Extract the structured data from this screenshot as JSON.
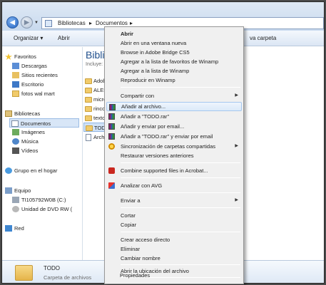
{
  "address": {
    "back_glyph": "◀",
    "forward_glyph": "▶",
    "history_glyph": "▼",
    "crumbs": [
      "Bibliotecas",
      "▸",
      "Documentos",
      "▸"
    ]
  },
  "toolbar": {
    "organize": "Organizar ▾",
    "open": "Abrir",
    "new_folder": "va carpeta"
  },
  "nav": {
    "items": [
      {
        "label": "Favoritos",
        "icon": "star-icon"
      },
      {
        "label": "Descargas",
        "icon": "downloads-icon"
      },
      {
        "label": "Sitios recientes",
        "icon": "recent-places-icon"
      },
      {
        "label": "Escritorio",
        "icon": "desktop-icon"
      },
      {
        "label": "fotos wal mart",
        "icon": "folder-icon"
      },
      {
        "label": "Bibliotecas",
        "icon": "libraries-icon"
      },
      {
        "label": "Documentos",
        "icon": "documents-icon"
      },
      {
        "label": "Imágenes",
        "icon": "pictures-icon"
      },
      {
        "label": "Música",
        "icon": "music-icon"
      },
      {
        "label": "Vídeos",
        "icon": "videos-icon"
      },
      {
        "label": "Grupo en el hogar",
        "icon": "homegroup-icon"
      },
      {
        "label": "Equipo",
        "icon": "computer-icon"
      },
      {
        "label": "TI105792W0B (C:)",
        "icon": "drive-icon"
      },
      {
        "label": "Unidad de DVD RW (",
        "icon": "dvd-icon"
      },
      {
        "label": "Red",
        "icon": "network-icon"
      }
    ]
  },
  "content": {
    "title": "Biblio",
    "includes": "Incluye:",
    "files": [
      "Adob",
      "ALES",
      "micro",
      "rinco",
      "texto",
      "TODO",
      "Archi"
    ]
  },
  "details": {
    "name": "TODO",
    "type": "Carpeta de archivos"
  },
  "menu": {
    "items": [
      {
        "label": "Abrir",
        "bold": true
      },
      {
        "label": "Abrir en una ventana nueva"
      },
      {
        "label": "Browse in Adobe Bridge CS5"
      },
      {
        "label": "Agregar a la lista de favoritos de Winamp"
      },
      {
        "label": "Agregar a la lista de Winamp"
      },
      {
        "label": "Reproducir en Winamp"
      },
      {
        "label": "Compartir con",
        "submenu": true
      },
      {
        "label": "Añadir al archivo...",
        "icon": "winrar-icon",
        "highlight": true
      },
      {
        "label": "Añadir a \"TODO.rar\"",
        "icon": "winrar-icon"
      },
      {
        "label": "Añadir y enviar por email...",
        "icon": "winrar-icon"
      },
      {
        "label": "Añadir a \"TODO.rar\" y enviar por email",
        "icon": "winrar-icon"
      },
      {
        "label": "Sincronización de carpetas compartidas",
        "icon": "sync-icon",
        "submenu": true
      },
      {
        "label": "Restaurar versiones anteriores"
      },
      {
        "label": "Combine supported files in Acrobat...",
        "icon": "acrobat-icon"
      },
      {
        "label": "Analizar con AVG",
        "icon": "avg-icon"
      },
      {
        "label": "Enviar a",
        "submenu": true
      },
      {
        "label": "Cortar"
      },
      {
        "label": "Copiar"
      },
      {
        "label": "Crear acceso directo"
      },
      {
        "label": "Eliminar"
      },
      {
        "label": "Cambiar nombre"
      },
      {
        "label": "Abrir la ubicación del archivo"
      },
      {
        "label": "Propiedades"
      }
    ],
    "submenu_glyph": "▶"
  }
}
